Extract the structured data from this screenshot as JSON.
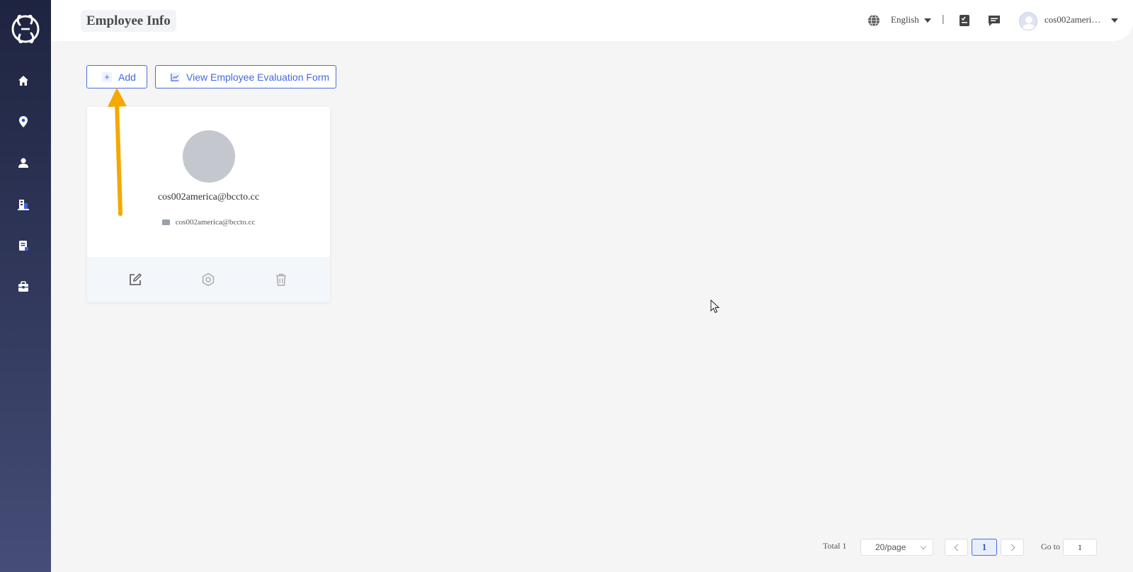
{
  "header": {
    "title": "Employee Info",
    "language": "English",
    "separator": "|",
    "user_name": "cos002ameri…"
  },
  "sidebar": {
    "items": [
      {
        "icon": "home-icon"
      },
      {
        "icon": "location-pin-icon"
      },
      {
        "icon": "user-icon"
      },
      {
        "icon": "building-icon"
      },
      {
        "icon": "document-icon"
      },
      {
        "icon": "briefcase-icon"
      }
    ]
  },
  "toolbar": {
    "add_label": "Add",
    "add_icon": "+",
    "view_form_label": "View Employee Evaluation Form"
  },
  "employees": [
    {
      "name": "cos002america@bccto.cc",
      "email": "cos002america@bccto.cc"
    }
  ],
  "pagination": {
    "total_label": "Total 1",
    "page_size": "20/page",
    "current_page": "1",
    "goto_label": "Go to",
    "goto_value": "1"
  },
  "colors": {
    "accent": "#4169e1",
    "sidebar_top": "#1e2440",
    "sidebar_bottom": "#464d78",
    "annotation_arrow": "#f5a800"
  }
}
